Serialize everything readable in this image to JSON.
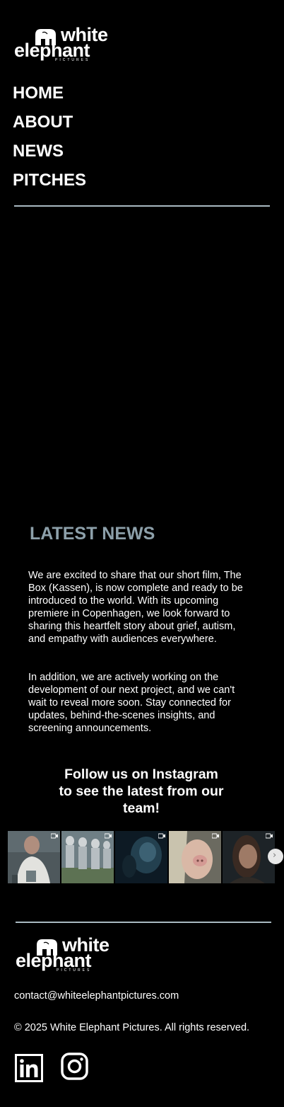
{
  "brand": {
    "word1": "white",
    "word2": "elephant",
    "word3": "PICTURES"
  },
  "nav": {
    "items": [
      {
        "label": "HOME"
      },
      {
        "label": "ABOUT"
      },
      {
        "label": "NEWS"
      },
      {
        "label": "PITCHES"
      }
    ]
  },
  "news": {
    "title": "LATEST NEWS",
    "paragraph1": "We are excited to share that our short film, The Box (Kassen), is now complete and ready to be introduced to the world. With its upcoming premiere in Copenhagen, we look forward to sharing this heartfelt story about grief, autism, and empathy with audiences everywhere.",
    "paragraph2": "In addition, we are actively working on the development of our next project, and we can't wait to reveal more soon. Stay connected for updates, behind-the-scenes insights, and screening announcements."
  },
  "instagram": {
    "heading": "Follow us on Instagram to see the latest from our team!",
    "tiles": [
      {
        "icon": "video-icon"
      },
      {
        "icon": "video-icon"
      },
      {
        "icon": "video-icon"
      },
      {
        "icon": "video-icon"
      },
      {
        "icon": "video-icon"
      }
    ],
    "next_icon": "chevron-right-icon"
  },
  "footer": {
    "email": "contact@whiteelephantpictures.com",
    "copyright": "© 2025 White Elephant Pictures. All rights reserved.",
    "social": [
      {
        "icon": "linkedin-icon"
      },
      {
        "icon": "instagram-icon"
      }
    ]
  },
  "colors": {
    "background": "#000000",
    "accent_title": "#8da0aa",
    "divider": "#a9b9c1",
    "text": "#ffffff"
  }
}
